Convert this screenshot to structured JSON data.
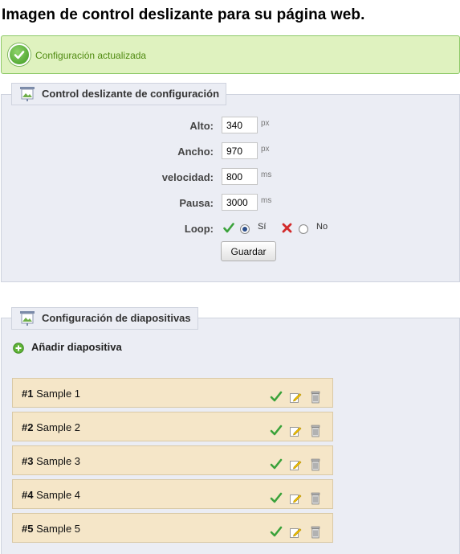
{
  "page": {
    "title": "Imagen de control deslizante para su página web."
  },
  "confirmation": {
    "text": "Configuración actualizada",
    "icon": "check-circle-icon",
    "color": "#4f8a10"
  },
  "slider_config": {
    "legend": "Control deslizante de configuración",
    "height": {
      "label": "Alto:",
      "value": "340",
      "unit": "px"
    },
    "width": {
      "label": "Ancho:",
      "value": "970",
      "unit": "px"
    },
    "speed": {
      "label": "velocidad:",
      "value": "800",
      "unit": "ms"
    },
    "pause": {
      "label": "Pausa:",
      "value": "3000",
      "unit": "ms"
    },
    "loop": {
      "label": "Loop:",
      "yes": "Sí",
      "no": "No",
      "selected": "yes"
    },
    "save_button": "Guardar"
  },
  "slides_config": {
    "legend": "Configuración de diapositivas",
    "add_label": "Añadir diapositiva",
    "slides": [
      {
        "num": "#1",
        "title": "Sample 1"
      },
      {
        "num": "#2",
        "title": "Sample 2"
      },
      {
        "num": "#3",
        "title": "Sample 3"
      },
      {
        "num": "#4",
        "title": "Sample 4"
      },
      {
        "num": "#5",
        "title": "Sample 5"
      }
    ]
  }
}
